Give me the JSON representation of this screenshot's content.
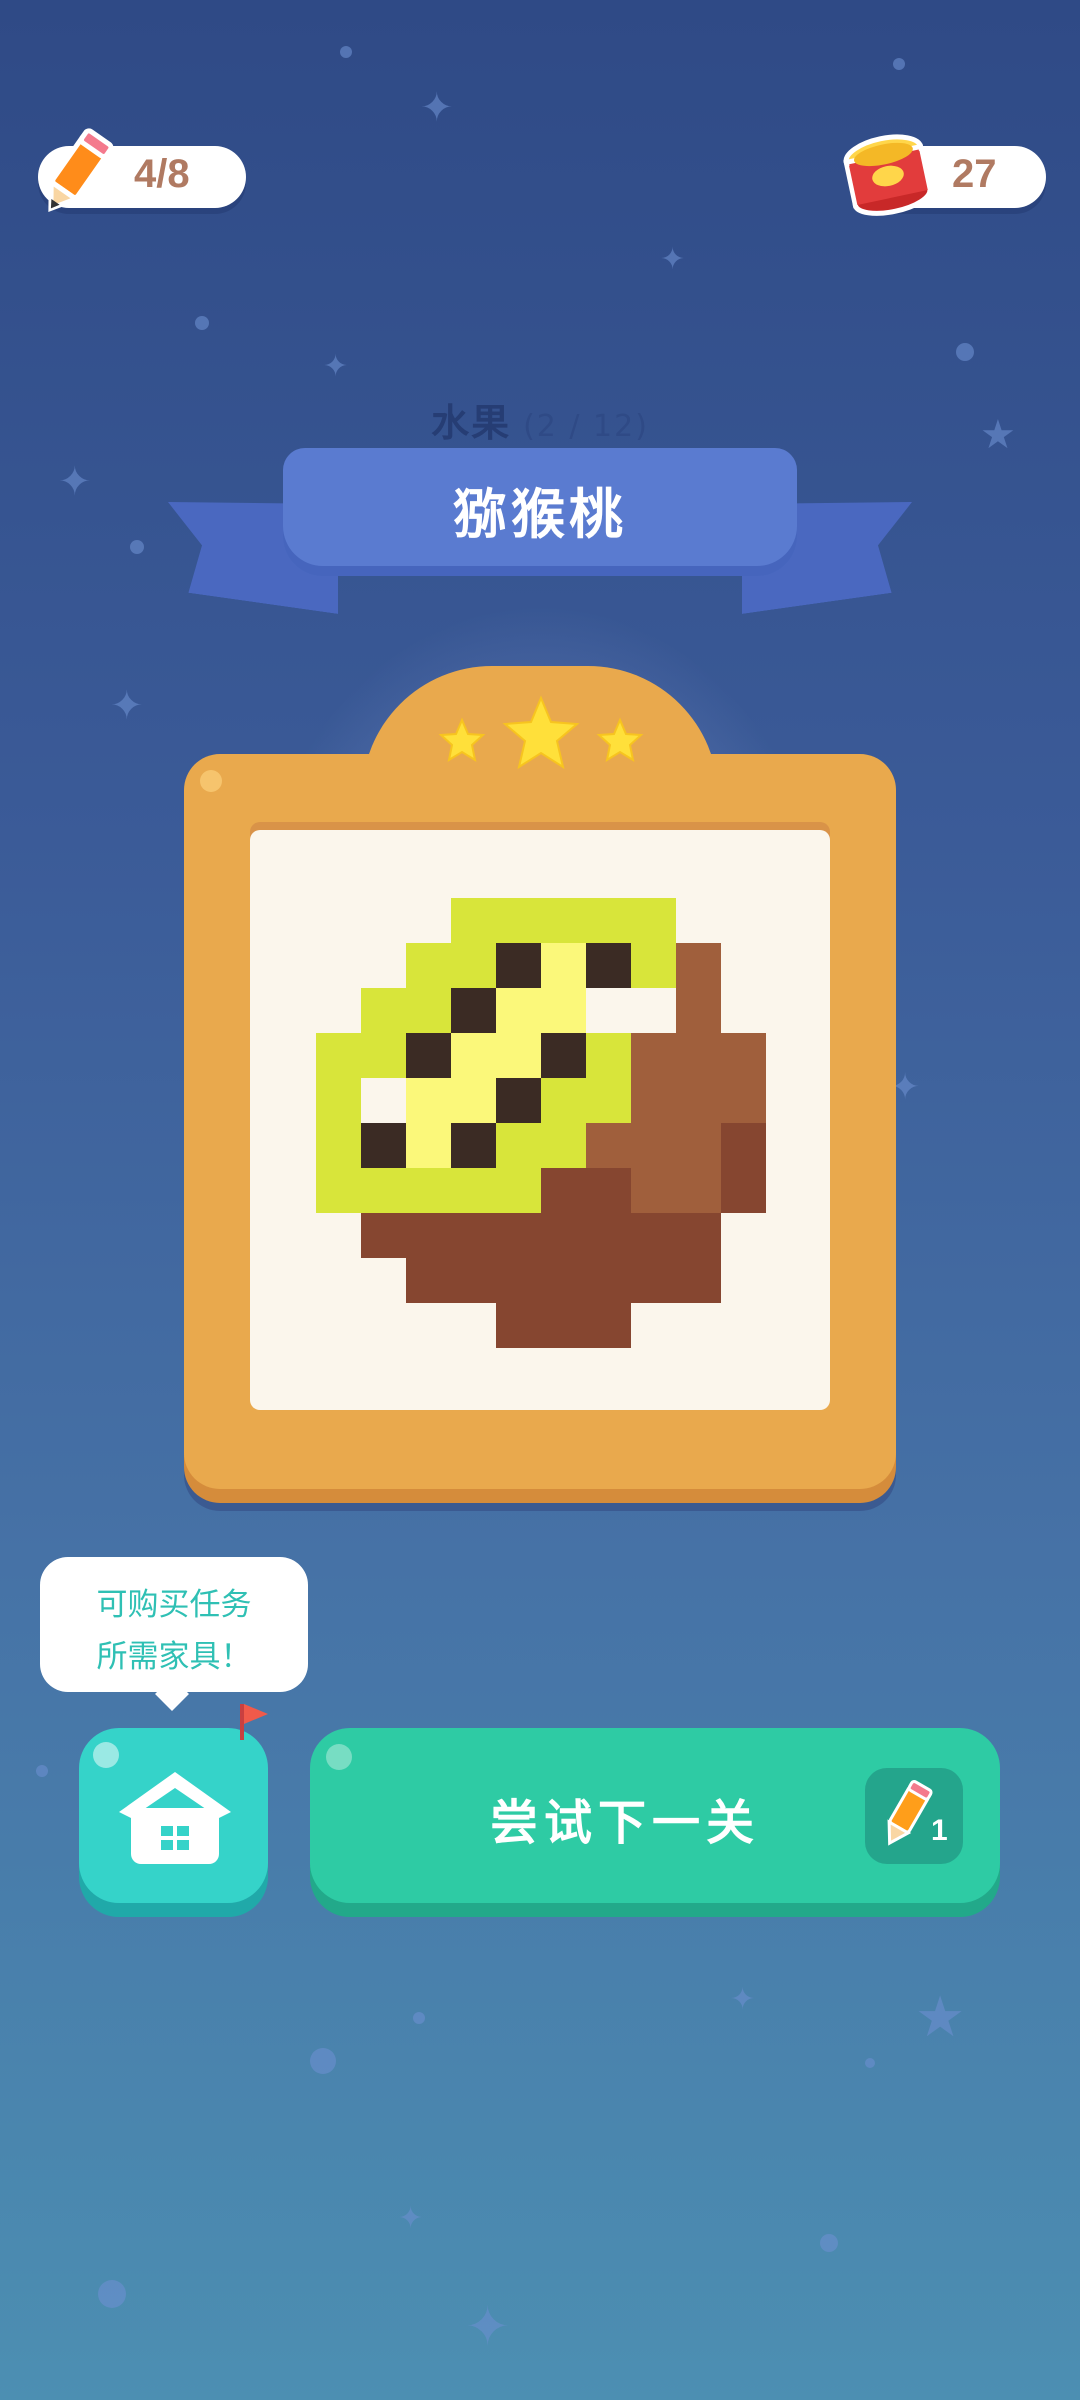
{
  "status_bar": {
    "pencils": "4/8",
    "coins": "27"
  },
  "level": {
    "category": "水果",
    "progress": "(2 / 12)",
    "title": "猕猴桃",
    "stars_earned": 3,
    "stars_total": 3
  },
  "tooltip": {
    "line1": "可购买任务",
    "line2": "所需家具！"
  },
  "buttons": {
    "next_label": "尝试下一关",
    "next_cost": "1"
  },
  "icons": {
    "pencil": "pencil-icon",
    "coin": "coin-can-icon",
    "home": "house-icon",
    "flag": "flag-icon",
    "star": "star-icon"
  },
  "colors": {
    "frame": "#e9a94d",
    "next_button": "#2ecba4",
    "home_button": "#35d3c9",
    "ribbon": "#5a7bd0"
  }
}
